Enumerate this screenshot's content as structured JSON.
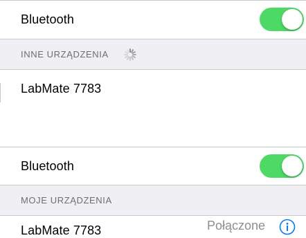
{
  "top_panel": {
    "bluetooth_label": "Bluetooth",
    "bluetooth_on": true,
    "section_header": "INNE URZĄDZENIA",
    "device_name": "LabMate 7783"
  },
  "bottom_panel": {
    "bluetooth_label": "Bluetooth",
    "bluetooth_on": true,
    "section_header": "MOJE URZĄDZENIA",
    "device_name": "LabMate 7783",
    "device_status": "Połączone"
  },
  "colors": {
    "toggle_on": "#4cd964",
    "accent": "#007aff",
    "section_background": "#efeff4",
    "separator": "#c8c7cc",
    "secondary_text": "#8e8e93"
  },
  "icons": [
    "activity-spinner-icon",
    "info-icon"
  ]
}
